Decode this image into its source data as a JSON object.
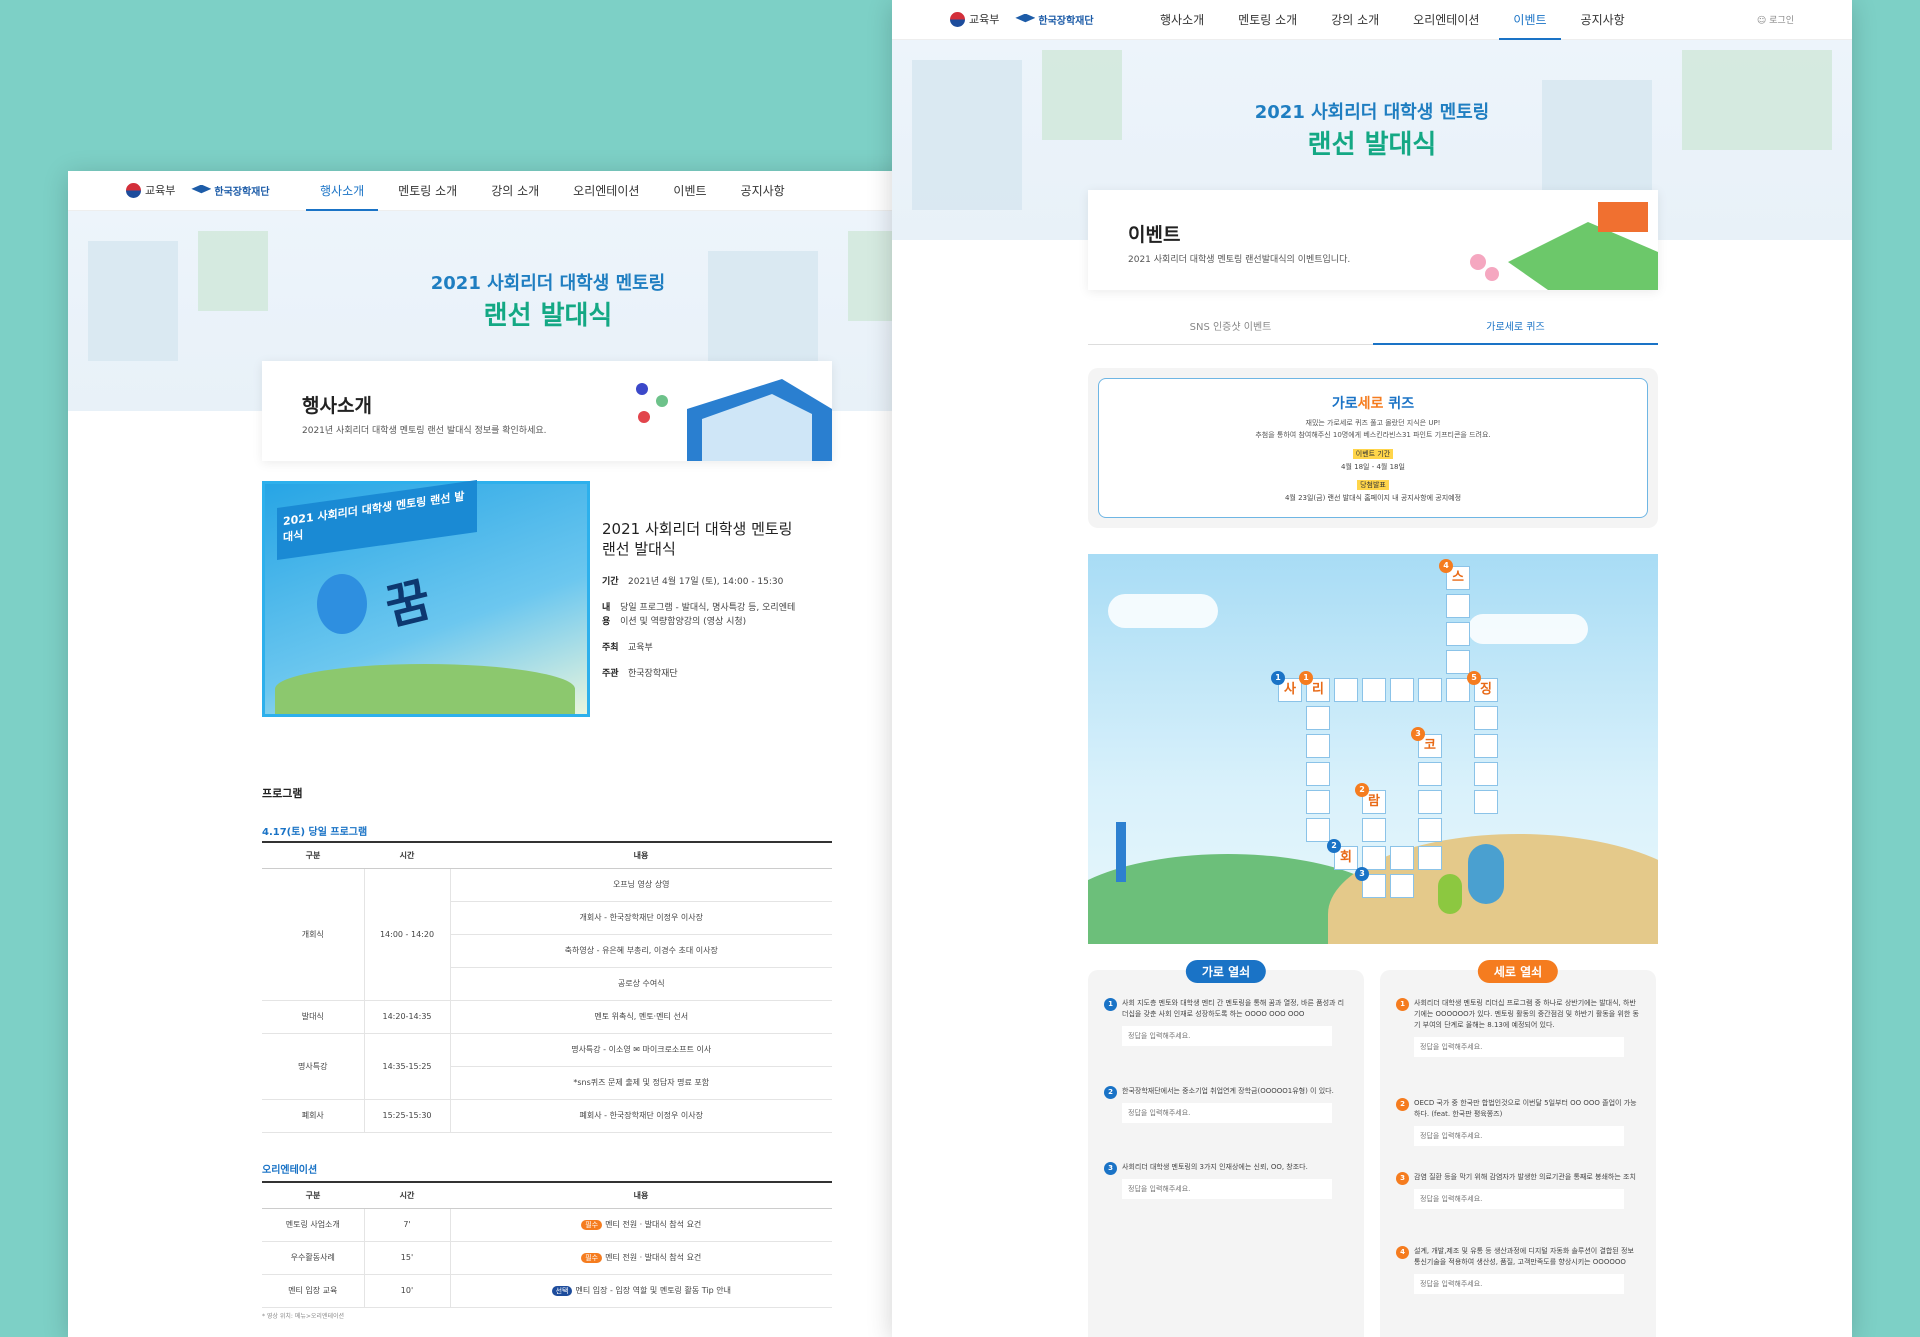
{
  "common": {
    "moe": "교육부",
    "kosaf": "한국장학재단",
    "login": "로그인",
    "hero_line1": "2021 사회리더 대학생 멘토링",
    "hero_line2": "랜선 발대식",
    "menu": [
      "행사소개",
      "멘토링 소개",
      "강의 소개",
      "오리엔테이션",
      "이벤트",
      "공지사항"
    ]
  },
  "left": {
    "card_title": "행사소개",
    "card_sub": "2021년 사회리더 대학생 멘토링 랜선 발대식 정보를 확인하세요.",
    "poster": {
      "banner": "2021 사회리더 대학생 멘토링 랜선 발대식",
      "slogan": "꿈"
    },
    "info_title": "2021 사회리더 대학생 멘토링 랜선 발대식",
    "info": [
      {
        "k": "기간",
        "v": "2021년 4월 17일 (토), 14:00 - 15:30"
      },
      {
        "k": "내용",
        "v": "당일 프로그램 - 발대식, 명사특강 등, 오리엔테이션 및 역량함양강의 (영상 시청)"
      },
      {
        "k": "주최",
        "v": "교육부"
      },
      {
        "k": "주관",
        "v": "한국장학재단"
      }
    ],
    "program_h": "프로그램",
    "day_h": "4.17(토) 당일 프로그램",
    "ori_h": "오리엔테이션",
    "th": [
      "구분",
      "시간",
      "내용"
    ],
    "day_rows": [
      {
        "a": "",
        "b": "",
        "c": "오프닝 영상 상영"
      },
      {
        "a": "개회식",
        "b": "14:00 - 14:20",
        "c": "개회사 - 한국장학재단 이정우 이사장"
      },
      {
        "a": "",
        "b": "",
        "c": "축하영상 - 유은혜 부총리, 이경수 초대 이사장"
      },
      {
        "a": "",
        "b": "",
        "c": "공로상 수여식"
      },
      {
        "a": "발대식",
        "b": "14:20-14:35",
        "c": "멘토 위촉식, 멘토·멘티 선서"
      },
      {
        "a": "",
        "b": "",
        "c": "명사특강 - 이소영 ✉ 마이크로소프트 이사"
      },
      {
        "a": "명사특강",
        "b": "14:35-15:25",
        "c": "*sns퀴즈 문제 출제 및 정답자 명료 포함"
      },
      {
        "a": "폐회사",
        "b": "15:25-15:30",
        "c": "폐회사 - 한국장학재단 이정우 이사장"
      }
    ],
    "ori_rows": [
      {
        "a": "멘토링 사업소개",
        "b": "7'",
        "tag": "필수",
        "c": "멘티 전원 · 발대식 참석 요건"
      },
      {
        "a": "우수활동사례",
        "b": "15'",
        "tag": "필수",
        "c": "멘티 전원 · 발대식 참석 요건"
      },
      {
        "a": "멘티 입장 교육",
        "b": "10'",
        "tag": "선택",
        "c": "멘티 입장 - 입장 역할 및 멘토링 활동 Tip 안내"
      }
    ],
    "foot": "* 영상 위치: 메뉴>오리엔테이션"
  },
  "right": {
    "card_title": "이벤트",
    "card_sub": "2021 사회리더 대학생 멘토링 랜선발대식의 이벤트입니다.",
    "tabs": [
      "SNS 인증샷 이벤트",
      "가로세로 퀴즈"
    ],
    "quiz": {
      "t1": "가로",
      "t2": "세로",
      "t3": " 퀴즈",
      "d1": "재밌는 가로세로 퀴즈 풀고 몰랐던 지식은 UP!",
      "d2": "추첨을 통하여 참여해주신 10명에게 베스킨라빈스31 파인트 기프티콘을 드려요.",
      "l1": "이벤트 기간",
      "v1": "4월 18일 - 4월 18일",
      "l2": "당첨발표",
      "v2": "4월 23일(금) 랜선 발대식 홈페이지 내 공지사항에 공지예정"
    },
    "letters": {
      "s": "스",
      "sa": "사",
      "ri": "리",
      "jing": "징",
      "ko": "코",
      "ram": "람",
      "hoe": "회"
    },
    "across_h": "가로 열쇠",
    "down_h": "세로 열쇠",
    "placeholder": "정답을 입력해주세요.",
    "across": [
      {
        "n": "1",
        "t": "사회 지도층 멘토와 대학생 멘티 간 멘토링을 통해 꿈과 열정, 바른 품성과 리더십을 갖춘 사회 인재로 성장하도록 하는 OOOO OOO OOO"
      },
      {
        "n": "2",
        "t": "한국장학재단에서는 중소기업 취업연계 장학금(OOOOO1유형) 이 있다."
      },
      {
        "n": "3",
        "t": "사회리더 대학생 멘토링의 3가지 인재상에는 신뢰, OO, 창조다."
      }
    ],
    "down": [
      {
        "n": "1",
        "t": "사회리더 대학생 멘토링 리더십 프로그램 중 하나로 상반기에는 발대식, 하반기에는 OOOOOO가 있다. 멘토링 활동의 중간점검 및 하반기 활동을 위한 동기 부여의 단계로 올해는 8.13에 예정되어 있다."
      },
      {
        "n": "2",
        "t": "OECD 국가 중 한국만 합법인것으로 이번달 5일부터 OO OOO 졸업이 가능하다. (feat. 한국판 평육쫑즈)"
      },
      {
        "n": "3",
        "t": "감염 질환 등을 막기 위해 감염자가 발생한 의료기관을 통째로 봉쇄하는 조치"
      },
      {
        "n": "4",
        "t": "설계, 개발,제조 및 유통 등 생산과정에 디지털 자동화 솔루션이 결합된 정보통신기술을 적용하여 생산성, 품질, 고객만족도를 향상시키는 OOOOOO"
      }
    ]
  },
  "colors": {
    "bg": "#7dd0c6",
    "accent": "#1a73c6",
    "green": "#14a884",
    "orange": "#f57c1f"
  }
}
